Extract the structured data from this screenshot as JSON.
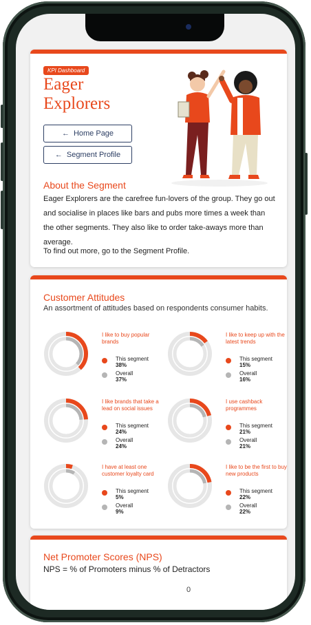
{
  "header": {
    "tag": "KPI Dashboard",
    "title": "Eager Explorers",
    "home_button": "Home Page",
    "segment_button": "Segment Profile"
  },
  "about": {
    "heading": "About the Segment",
    "text": "Eager Explorers are the carefree fun-lovers of the group. They go out and socialise in places like bars and pubs more times a week than the other segments. They also like to order take-aways more than average.",
    "more": "To find out more, go to the Segment Profile."
  },
  "attitudes": {
    "heading": "Customer Attitudes",
    "subtitle": "An assortment of attitudes based on respondents consumer habits.",
    "segment_label": "This segment",
    "overall_label": "Overall",
    "items": [
      {
        "label": "I like to buy popular brands",
        "segment": "38%",
        "overall": "37%",
        "segment_value": 0.38,
        "overall_value": 0.37
      },
      {
        "label": "I like to keep up with the latest trends",
        "segment": "15%",
        "overall": "16%",
        "segment_value": 0.15,
        "overall_value": 0.16
      },
      {
        "label": "I like brands that take a lead on social issues",
        "segment": "24%",
        "overall": "24%",
        "segment_value": 0.24,
        "overall_value": 0.24
      },
      {
        "label": "I use cashback programmes",
        "segment": "21%",
        "overall": "21%",
        "segment_value": 0.21,
        "overall_value": 0.21
      },
      {
        "label": "I have at least one customer loyalty card",
        "segment": "5%",
        "overall": "9%",
        "segment_value": 0.05,
        "overall_value": 0.09
      },
      {
        "label": "I like to be the first to buy new products",
        "segment": "22%",
        "overall": "22%",
        "segment_value": 0.22,
        "overall_value": 0.22
      }
    ]
  },
  "nps": {
    "heading": "Net Promoter Scores (NPS)",
    "subtitle": "NPS = % of Promoters minus % of Detractors",
    "value": "0"
  },
  "colors": {
    "accent": "#e8481c",
    "overall": "#b5b5b5",
    "track": "#e6e6e6",
    "navy": "#2c3e63"
  }
}
